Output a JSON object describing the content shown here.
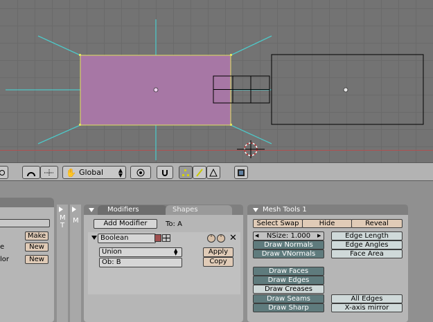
{
  "toolbar": {
    "orientation": "Global"
  },
  "sidebar_labels": {
    "m_t_first": "M",
    "m_t_second": "T",
    "m_second": "M"
  },
  "left_panel": {
    "make_label": "Make",
    "new_label_1": "New",
    "new_label_2": "New",
    "row1_text": "e",
    "row2_text": "lor"
  },
  "modifiers_panel": {
    "tab_modifiers": "Modifiers",
    "tab_shapes": "Shapes",
    "add_modifier": "Add Modifier",
    "to_label": "To: A",
    "modifier_name": "Boolean",
    "operation": "Union",
    "object": "Ob: B",
    "apply": "Apply",
    "copy": "Copy"
  },
  "mesh_tools": {
    "title": "Mesh Tools 1",
    "select_swap": "Select Swap",
    "hide": "Hide",
    "reveal": "Reveal",
    "nsize": "NSize: 1.000",
    "draw_normals": "Draw Normals",
    "draw_vnormals": "Draw VNormals",
    "edge_length": "Edge Length",
    "edge_angles": "Edge Angles",
    "face_area": "Face Area",
    "draw_faces": "Draw Faces",
    "draw_edges": "Draw Edges",
    "draw_creases": "Draw Creases",
    "draw_seams": "Draw Seams",
    "draw_sharp": "Draw Sharp",
    "all_edges": "All Edges",
    "x_axis_mirror": "X-axis mirror"
  }
}
